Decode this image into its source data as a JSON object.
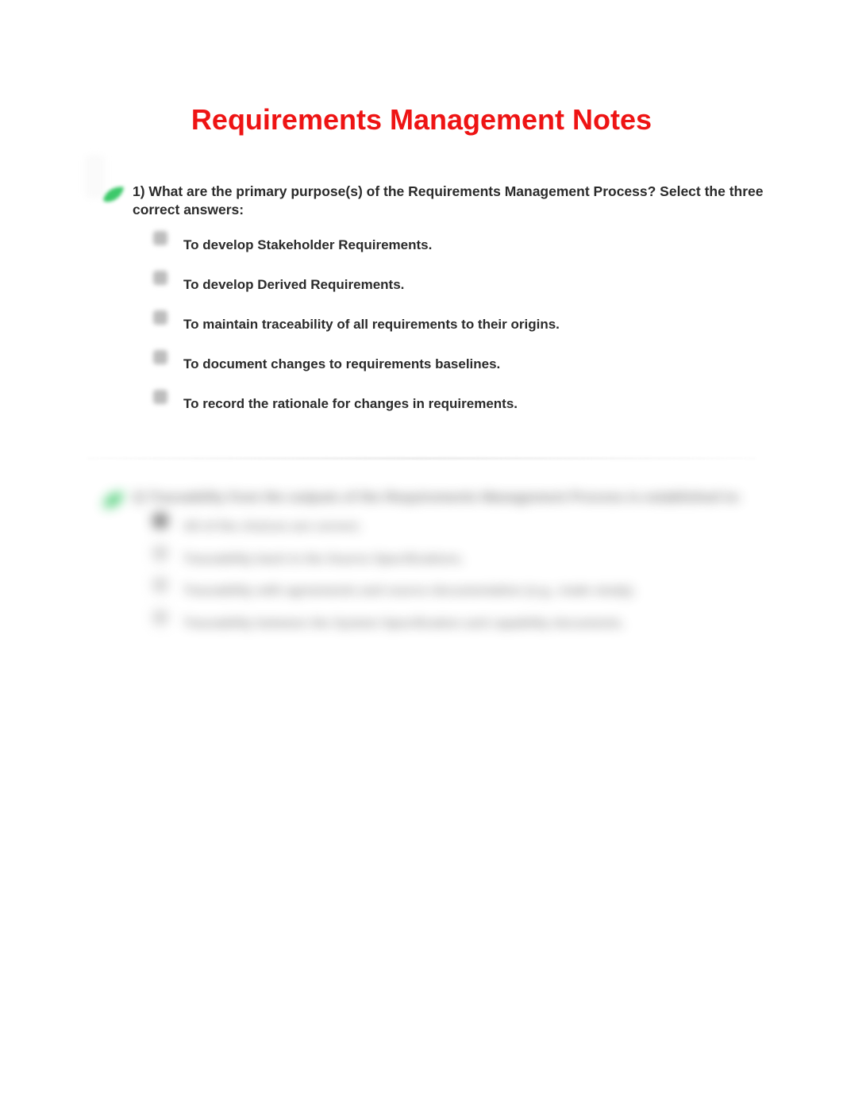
{
  "title": "Requirements Management Notes",
  "questions": [
    {
      "prompt": "1) What are the primary purpose(s) of the Requirements Management Process? Select the three correct answers:",
      "options": [
        {
          "text": "To develop Stakeholder Requirements."
        },
        {
          "text": "To develop Derived Requirements."
        },
        {
          "text": "To maintain traceability of all requirements to their origins."
        },
        {
          "text": "To document changes to requirements baselines."
        },
        {
          "text": "To record the rationale for changes in requirements."
        }
      ]
    },
    {
      "prompt": "2) Traceability from the outputs of the Requirements Management Process is established to:",
      "options": [
        {
          "text": "All of the choices are correct."
        },
        {
          "text": "Traceability back to the Source Specifications."
        },
        {
          "text": "Traceability with agreements and source documentation (e.g., trade study)."
        },
        {
          "text": "Traceability between the System Specification and capability documents."
        }
      ]
    }
  ]
}
